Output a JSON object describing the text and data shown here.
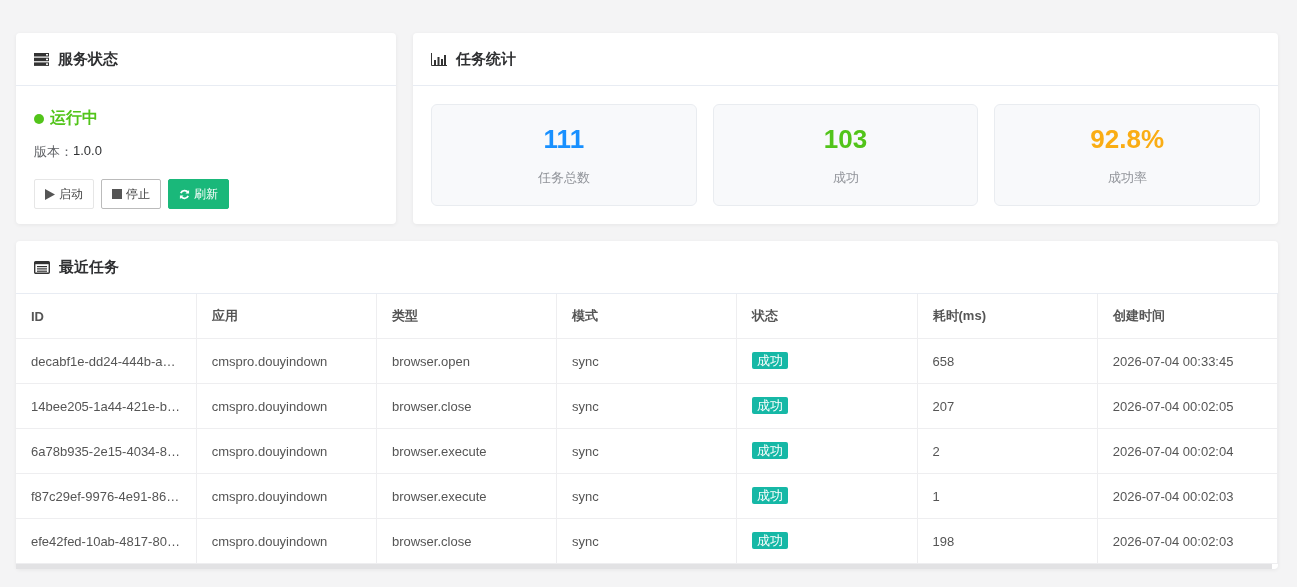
{
  "service": {
    "title": "服务状态",
    "running": true,
    "status": "运行中",
    "version_label": "版本：",
    "version": "1.0.0",
    "buttons": [
      {
        "label": "启动",
        "kind": "plain"
      },
      {
        "label": "停止",
        "kind": "outline"
      },
      {
        "label": "刷新",
        "kind": "primary"
      }
    ]
  },
  "stats": {
    "title": "任务统计",
    "items": [
      {
        "value": "111",
        "label": "任务总数",
        "color": "#1890ff"
      },
      {
        "value": "103",
        "label": "成功",
        "color": "#52c41a"
      },
      {
        "value": "92.8%",
        "label": "成功率",
        "color": "#faad14"
      }
    ]
  },
  "recent": {
    "title": "最近任务",
    "columns": [
      "ID",
      "应用",
      "类型",
      "模式",
      "状态",
      "耗时(ms)",
      "创建时间"
    ],
    "rows": [
      [
        "decabf1e-dd24-444b-a…",
        "cmspro.douyindown",
        "browser.open",
        "sync",
        "成功",
        "658",
        "2026-07-04 00:33:45"
      ],
      [
        "14bee205-1a44-421e-b…",
        "cmspro.douyindown",
        "browser.close",
        "sync",
        "成功",
        "207",
        "2026-07-04 00:02:05"
      ],
      [
        "6a78b935-2e15-4034-8…",
        "cmspro.douyindown",
        "browser.execute",
        "sync",
        "成功",
        "2",
        "2026-07-04 00:02:04"
      ],
      [
        "f87c29ef-9976-4e91-86…",
        "cmspro.douyindown",
        "browser.execute",
        "sync",
        "成功",
        "1",
        "2026-07-04 00:02:03"
      ],
      [
        "efe42fed-10ab-4817-80…",
        "cmspro.douyindown",
        "browser.close",
        "sync",
        "成功",
        "198",
        "2026-07-04 00:02:03"
      ]
    ]
  }
}
